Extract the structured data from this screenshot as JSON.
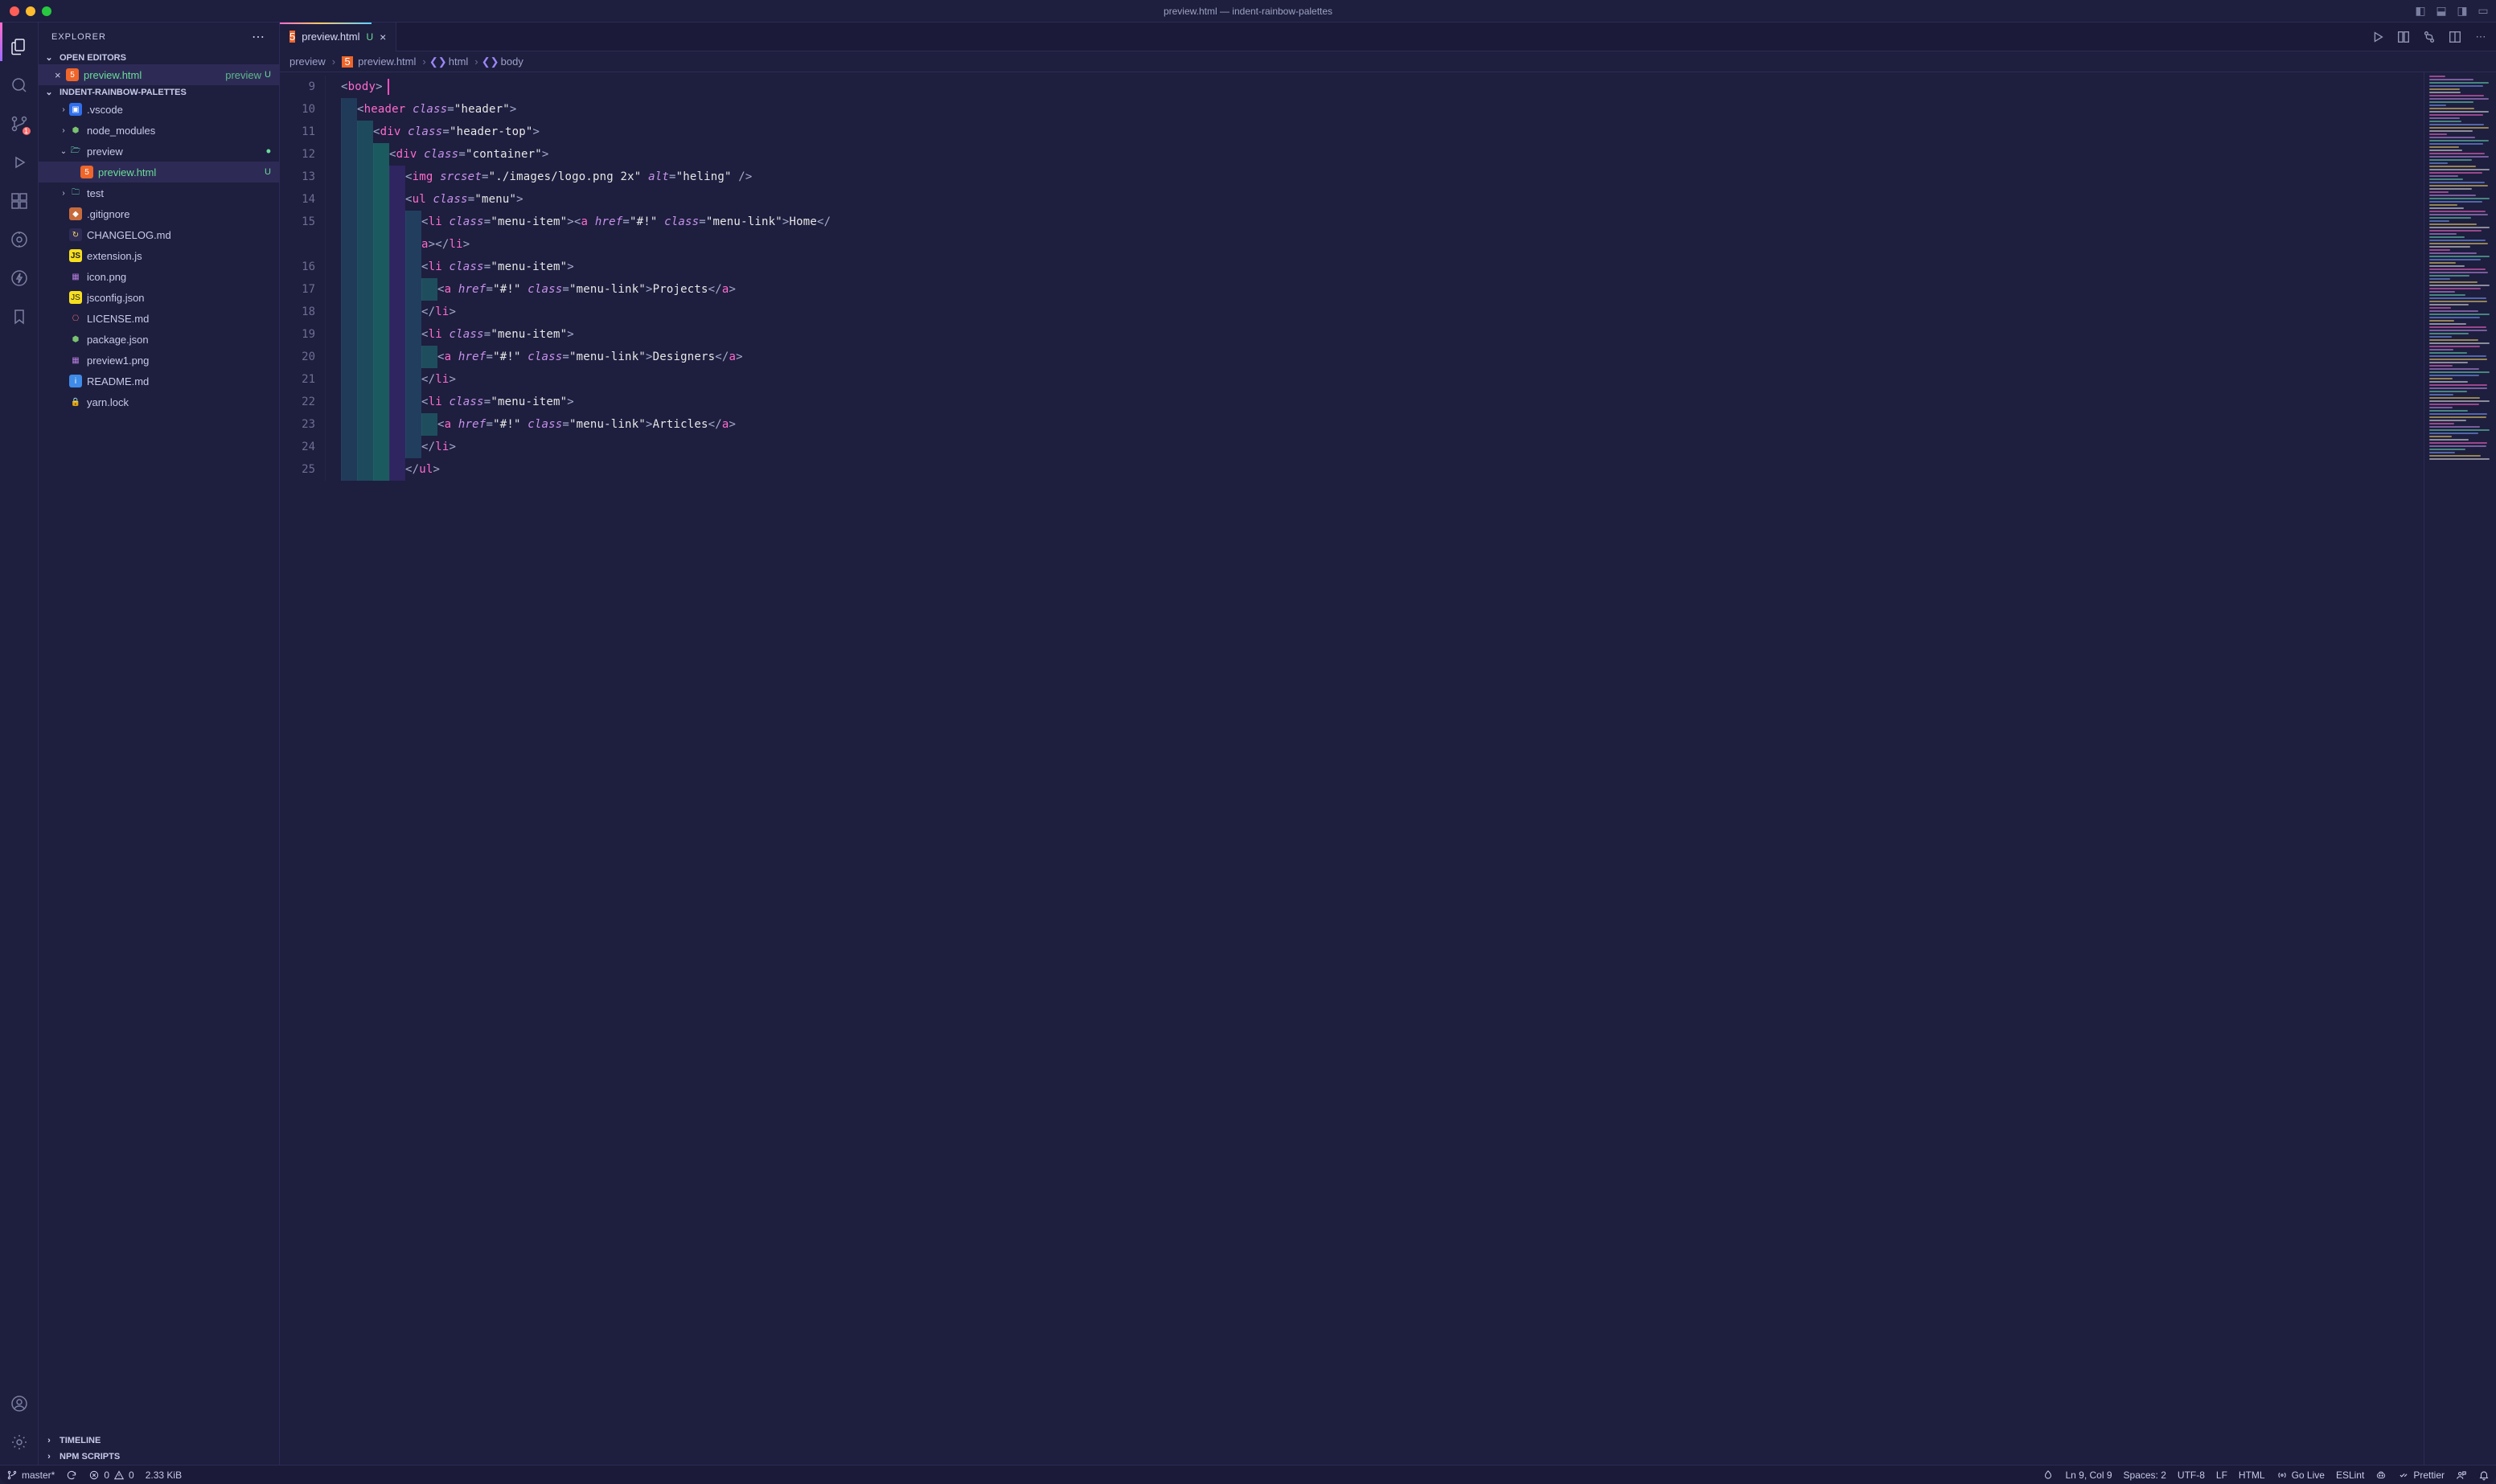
{
  "titlebar": {
    "title": "preview.html — indent-rainbow-palettes"
  },
  "activitybar": {
    "scm_badge": "1"
  },
  "sidebar": {
    "title": "EXPLORER",
    "open_editors_header": "OPEN EDITORS",
    "open_editors": [
      {
        "name": "preview.html",
        "hint": "preview",
        "status": "U",
        "close_glyph": "×"
      }
    ],
    "workspace_header": "INDENT-RAINBOW-PALETTES",
    "tree": [
      {
        "depth": 1,
        "kind": "folder",
        "expanded": false,
        "name": ".vscode",
        "icon": "folder-vscode"
      },
      {
        "depth": 1,
        "kind": "folder",
        "expanded": false,
        "name": "node_modules",
        "icon": "folder-node"
      },
      {
        "depth": 1,
        "kind": "folder-open",
        "expanded": true,
        "name": "preview",
        "icon": "folder-open",
        "git": "dot"
      },
      {
        "depth": 2,
        "kind": "file",
        "name": "preview.html",
        "icon": "html5",
        "git": "U",
        "selected": true
      },
      {
        "depth": 1,
        "kind": "folder",
        "expanded": false,
        "name": "test",
        "icon": "folder-test"
      },
      {
        "depth": 1,
        "kind": "file",
        "name": ".gitignore",
        "icon": "git"
      },
      {
        "depth": 1,
        "kind": "file",
        "name": "CHANGELOG.md",
        "icon": "changelog"
      },
      {
        "depth": 1,
        "kind": "file",
        "name": "extension.js",
        "icon": "js"
      },
      {
        "depth": 1,
        "kind": "file",
        "name": "icon.png",
        "icon": "image"
      },
      {
        "depth": 1,
        "kind": "file",
        "name": "jsconfig.json",
        "icon": "jsconfig"
      },
      {
        "depth": 1,
        "kind": "file",
        "name": "LICENSE.md",
        "icon": "license"
      },
      {
        "depth": 1,
        "kind": "file",
        "name": "package.json",
        "icon": "node"
      },
      {
        "depth": 1,
        "kind": "file",
        "name": "preview1.png",
        "icon": "image"
      },
      {
        "depth": 1,
        "kind": "file",
        "name": "README.md",
        "icon": "info"
      },
      {
        "depth": 1,
        "kind": "file",
        "name": "yarn.lock",
        "icon": "lock"
      }
    ],
    "bottom_sections": [
      "TIMELINE",
      "NPM SCRIPTS"
    ]
  },
  "editor": {
    "tab": {
      "name": "preview.html",
      "status": "U",
      "close": "×"
    },
    "breadcrumbs": [
      {
        "label": "preview",
        "icon": null
      },
      {
        "label": "preview.html",
        "icon": "html5"
      },
      {
        "label": "html",
        "icon": "brackets"
      },
      {
        "label": "body",
        "icon": "brackets"
      }
    ],
    "first_line_no": 9,
    "lines": [
      {
        "indent": 1,
        "tokens": [
          [
            "punc",
            "<"
          ],
          [
            "tag",
            "body"
          ],
          [
            "punc",
            ">"
          ]
        ],
        "cursor_after": true
      },
      {
        "indent": 2,
        "tokens": [
          [
            "punc",
            "<"
          ],
          [
            "tag",
            "header"
          ],
          [
            "punc",
            " "
          ],
          [
            "attr",
            "class"
          ],
          [
            "punc",
            "="
          ],
          [
            "str",
            "\"header\""
          ],
          [
            "punc",
            ">"
          ]
        ]
      },
      {
        "indent": 3,
        "tokens": [
          [
            "punc",
            "<"
          ],
          [
            "tag",
            "div"
          ],
          [
            "punc",
            " "
          ],
          [
            "attr",
            "class"
          ],
          [
            "punc",
            "="
          ],
          [
            "str",
            "\"header-top\""
          ],
          [
            "punc",
            ">"
          ]
        ]
      },
      {
        "indent": 4,
        "tokens": [
          [
            "punc",
            "<"
          ],
          [
            "tag",
            "div"
          ],
          [
            "punc",
            " "
          ],
          [
            "attr",
            "class"
          ],
          [
            "punc",
            "="
          ],
          [
            "str",
            "\"container\""
          ],
          [
            "punc",
            ">"
          ]
        ]
      },
      {
        "indent": 5,
        "tokens": [
          [
            "punc",
            "<"
          ],
          [
            "tag",
            "img"
          ],
          [
            "punc",
            " "
          ],
          [
            "attr",
            "srcset"
          ],
          [
            "punc",
            "="
          ],
          [
            "str",
            "\"./images/logo.png 2x\""
          ],
          [
            "punc",
            " "
          ],
          [
            "attr",
            "alt"
          ],
          [
            "punc",
            "="
          ],
          [
            "str",
            "\"heling\""
          ],
          [
            "punc",
            " />"
          ]
        ]
      },
      {
        "indent": 5,
        "tokens": [
          [
            "punc",
            "<"
          ],
          [
            "tag",
            "ul"
          ],
          [
            "punc",
            " "
          ],
          [
            "attr",
            "class"
          ],
          [
            "punc",
            "="
          ],
          [
            "str",
            "\"menu\""
          ],
          [
            "punc",
            ">"
          ]
        ]
      },
      {
        "indent": 6,
        "wrap": true,
        "tokens": [
          [
            "punc",
            "<"
          ],
          [
            "tag",
            "li"
          ],
          [
            "punc",
            " "
          ],
          [
            "attr",
            "class"
          ],
          [
            "punc",
            "="
          ],
          [
            "str",
            "\"menu-item\""
          ],
          [
            "punc",
            "><"
          ],
          [
            "tag",
            "a"
          ],
          [
            "punc",
            " "
          ],
          [
            "attr",
            "href"
          ],
          [
            "punc",
            "="
          ],
          [
            "str",
            "\"#!\""
          ],
          [
            "punc",
            " "
          ],
          [
            "attr",
            "class"
          ],
          [
            "punc",
            "="
          ],
          [
            "str",
            "\"menu-link\""
          ],
          [
            "punc",
            ">"
          ],
          [
            "text",
            "Home"
          ],
          [
            "punc",
            "</"
          ]
        ]
      },
      {
        "indent": 6,
        "continuation": true,
        "tokens": [
          [
            "tag",
            "a"
          ],
          [
            "punc",
            "></"
          ],
          [
            "tag",
            "li"
          ],
          [
            "punc",
            ">"
          ]
        ]
      },
      {
        "indent": 6,
        "tokens": [
          [
            "punc",
            "<"
          ],
          [
            "tag",
            "li"
          ],
          [
            "punc",
            " "
          ],
          [
            "attr",
            "class"
          ],
          [
            "punc",
            "="
          ],
          [
            "str",
            "\"menu-item\""
          ],
          [
            "punc",
            ">"
          ]
        ]
      },
      {
        "indent": 7,
        "tokens": [
          [
            "punc",
            "<"
          ],
          [
            "tag",
            "a"
          ],
          [
            "punc",
            " "
          ],
          [
            "attr",
            "href"
          ],
          [
            "punc",
            "="
          ],
          [
            "str",
            "\"#!\""
          ],
          [
            "punc",
            " "
          ],
          [
            "attr",
            "class"
          ],
          [
            "punc",
            "="
          ],
          [
            "str",
            "\"menu-link\""
          ],
          [
            "punc",
            ">"
          ],
          [
            "text",
            "Projects"
          ],
          [
            "punc",
            "</"
          ],
          [
            "tag",
            "a"
          ],
          [
            "punc",
            ">"
          ]
        ]
      },
      {
        "indent": 6,
        "tokens": [
          [
            "punc",
            "</"
          ],
          [
            "tag",
            "li"
          ],
          [
            "punc",
            ">"
          ]
        ]
      },
      {
        "indent": 6,
        "tokens": [
          [
            "punc",
            "<"
          ],
          [
            "tag",
            "li"
          ],
          [
            "punc",
            " "
          ],
          [
            "attr",
            "class"
          ],
          [
            "punc",
            "="
          ],
          [
            "str",
            "\"menu-item\""
          ],
          [
            "punc",
            ">"
          ]
        ]
      },
      {
        "indent": 7,
        "tokens": [
          [
            "punc",
            "<"
          ],
          [
            "tag",
            "a"
          ],
          [
            "punc",
            " "
          ],
          [
            "attr",
            "href"
          ],
          [
            "punc",
            "="
          ],
          [
            "str",
            "\"#!\""
          ],
          [
            "punc",
            " "
          ],
          [
            "attr",
            "class"
          ],
          [
            "punc",
            "="
          ],
          [
            "str",
            "\"menu-link\""
          ],
          [
            "punc",
            ">"
          ],
          [
            "text",
            "Designers"
          ],
          [
            "punc",
            "</"
          ],
          [
            "tag",
            "a"
          ],
          [
            "punc",
            ">"
          ]
        ]
      },
      {
        "indent": 6,
        "tokens": [
          [
            "punc",
            "</"
          ],
          [
            "tag",
            "li"
          ],
          [
            "punc",
            ">"
          ]
        ]
      },
      {
        "indent": 6,
        "tokens": [
          [
            "punc",
            "<"
          ],
          [
            "tag",
            "li"
          ],
          [
            "punc",
            " "
          ],
          [
            "attr",
            "class"
          ],
          [
            "punc",
            "="
          ],
          [
            "str",
            "\"menu-item\""
          ],
          [
            "punc",
            ">"
          ]
        ]
      },
      {
        "indent": 7,
        "tokens": [
          [
            "punc",
            "<"
          ],
          [
            "tag",
            "a"
          ],
          [
            "punc",
            " "
          ],
          [
            "attr",
            "href"
          ],
          [
            "punc",
            "="
          ],
          [
            "str",
            "\"#!\""
          ],
          [
            "punc",
            " "
          ],
          [
            "attr",
            "class"
          ],
          [
            "punc",
            "="
          ],
          [
            "str",
            "\"menu-link\""
          ],
          [
            "punc",
            ">"
          ],
          [
            "text",
            "Articles"
          ],
          [
            "punc",
            "</"
          ],
          [
            "tag",
            "a"
          ],
          [
            "punc",
            ">"
          ]
        ]
      },
      {
        "indent": 6,
        "tokens": [
          [
            "punc",
            "</"
          ],
          [
            "tag",
            "li"
          ],
          [
            "punc",
            ">"
          ]
        ]
      },
      {
        "indent": 5,
        "tokens": [
          [
            "punc",
            "</"
          ],
          [
            "tag",
            "ul"
          ],
          [
            "punc",
            ">"
          ]
        ]
      }
    ]
  },
  "statusbar": {
    "branch": "master*",
    "errors": "0",
    "warnings": "0",
    "size": "2.33 KiB",
    "cursor": "Ln 9, Col 9",
    "spaces": "Spaces: 2",
    "encoding": "UTF-8",
    "eol": "LF",
    "lang": "HTML",
    "golive": "Go Live",
    "eslint": "ESLint",
    "prettier": "Prettier"
  },
  "colors": {
    "accent_pink": "#ff6bcb",
    "accent_purple": "#c792ea",
    "accent_green": "#6adc99",
    "bg": "#1e1e3f"
  }
}
